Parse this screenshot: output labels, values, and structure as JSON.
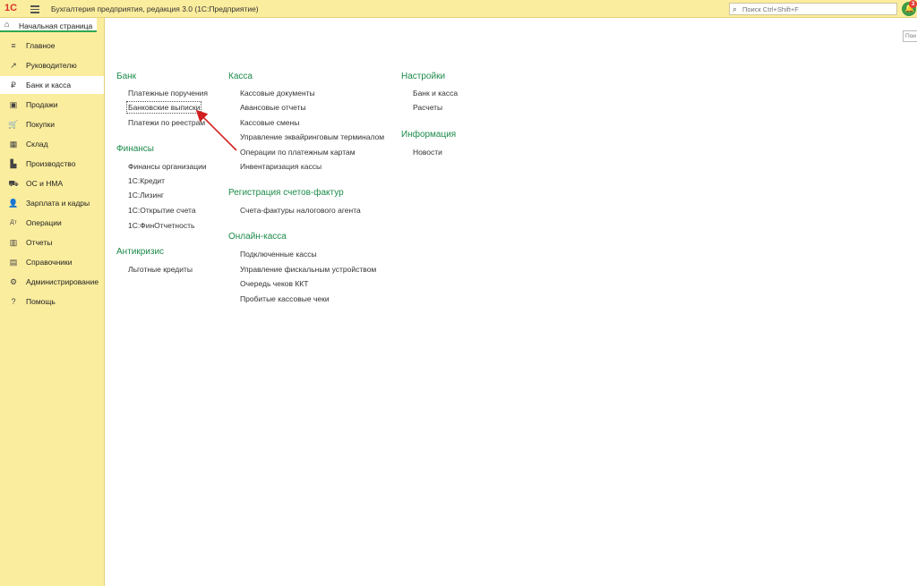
{
  "titlebar": {
    "logo": "1С",
    "app_title": "Бухгалтерия предприятия, редакция 3.0  (1С:Предприятие)",
    "search_placeholder": "Поиск Ctrl+Shift+F",
    "notification_count": "3"
  },
  "sidebar": {
    "home_tab": "Начальная страница",
    "items": [
      {
        "label": "Главное",
        "icon": "≡"
      },
      {
        "label": "Руководителю",
        "icon": "↗"
      },
      {
        "label": "Банк и касса",
        "icon": "₽"
      },
      {
        "label": "Продажи",
        "icon": "▣"
      },
      {
        "label": "Покупки",
        "icon": "🛒"
      },
      {
        "label": "Склад",
        "icon": "▦"
      },
      {
        "label": "Производство",
        "icon": "▙"
      },
      {
        "label": "ОС и НМА",
        "icon": "⛟"
      },
      {
        "label": "Зарплата и кадры",
        "icon": "👤"
      },
      {
        "label": "Операции",
        "icon": "Дт"
      },
      {
        "label": "Отчеты",
        "icon": "▥"
      },
      {
        "label": "Справочники",
        "icon": "▤"
      },
      {
        "label": "Администрирование",
        "icon": "⚙"
      },
      {
        "label": "Помощь",
        "icon": "?"
      }
    ]
  },
  "main": {
    "right_stub_text": "Пои",
    "col1": {
      "bank": {
        "title": "Банк",
        "links": [
          "Платежные поручения",
          "Банковские выписки",
          "Платежи по реестрам"
        ]
      },
      "finance": {
        "title": "Финансы",
        "links": [
          "Финансы организации",
          "1С:Кредит",
          "1С:Лизинг",
          "1С:Открытие счета",
          "1С:ФинОтчетность"
        ]
      },
      "anticrisis": {
        "title": "Антикризис",
        "links": [
          "Льготные кредиты"
        ]
      }
    },
    "col2": {
      "kassa": {
        "title": "Касса",
        "links": [
          "Кассовые документы",
          "Авансовые отчеты",
          "Кассовые смены",
          "Управление эквайринговым терминалом",
          "Операции по платежным картам",
          "Инвентаризация кассы"
        ]
      },
      "invoices": {
        "title": "Регистрация счетов-фактур",
        "links": [
          "Счета-фактуры налогового агента"
        ]
      },
      "online": {
        "title": "Онлайн-касса",
        "links": [
          "Подключенные кассы",
          "Управление фискальным устройством",
          "Очередь чеков ККТ",
          "Пробитые кассовые чеки"
        ]
      }
    },
    "col3": {
      "settings": {
        "title": "Настройки",
        "links": [
          "Банк и касса",
          "Расчеты"
        ]
      },
      "info": {
        "title": "Информация",
        "links": [
          "Новости"
        ]
      }
    }
  },
  "colors": {
    "panel": "#FBED9E",
    "section_title": "#1c8a4a",
    "arrow": "#d11f1f"
  }
}
